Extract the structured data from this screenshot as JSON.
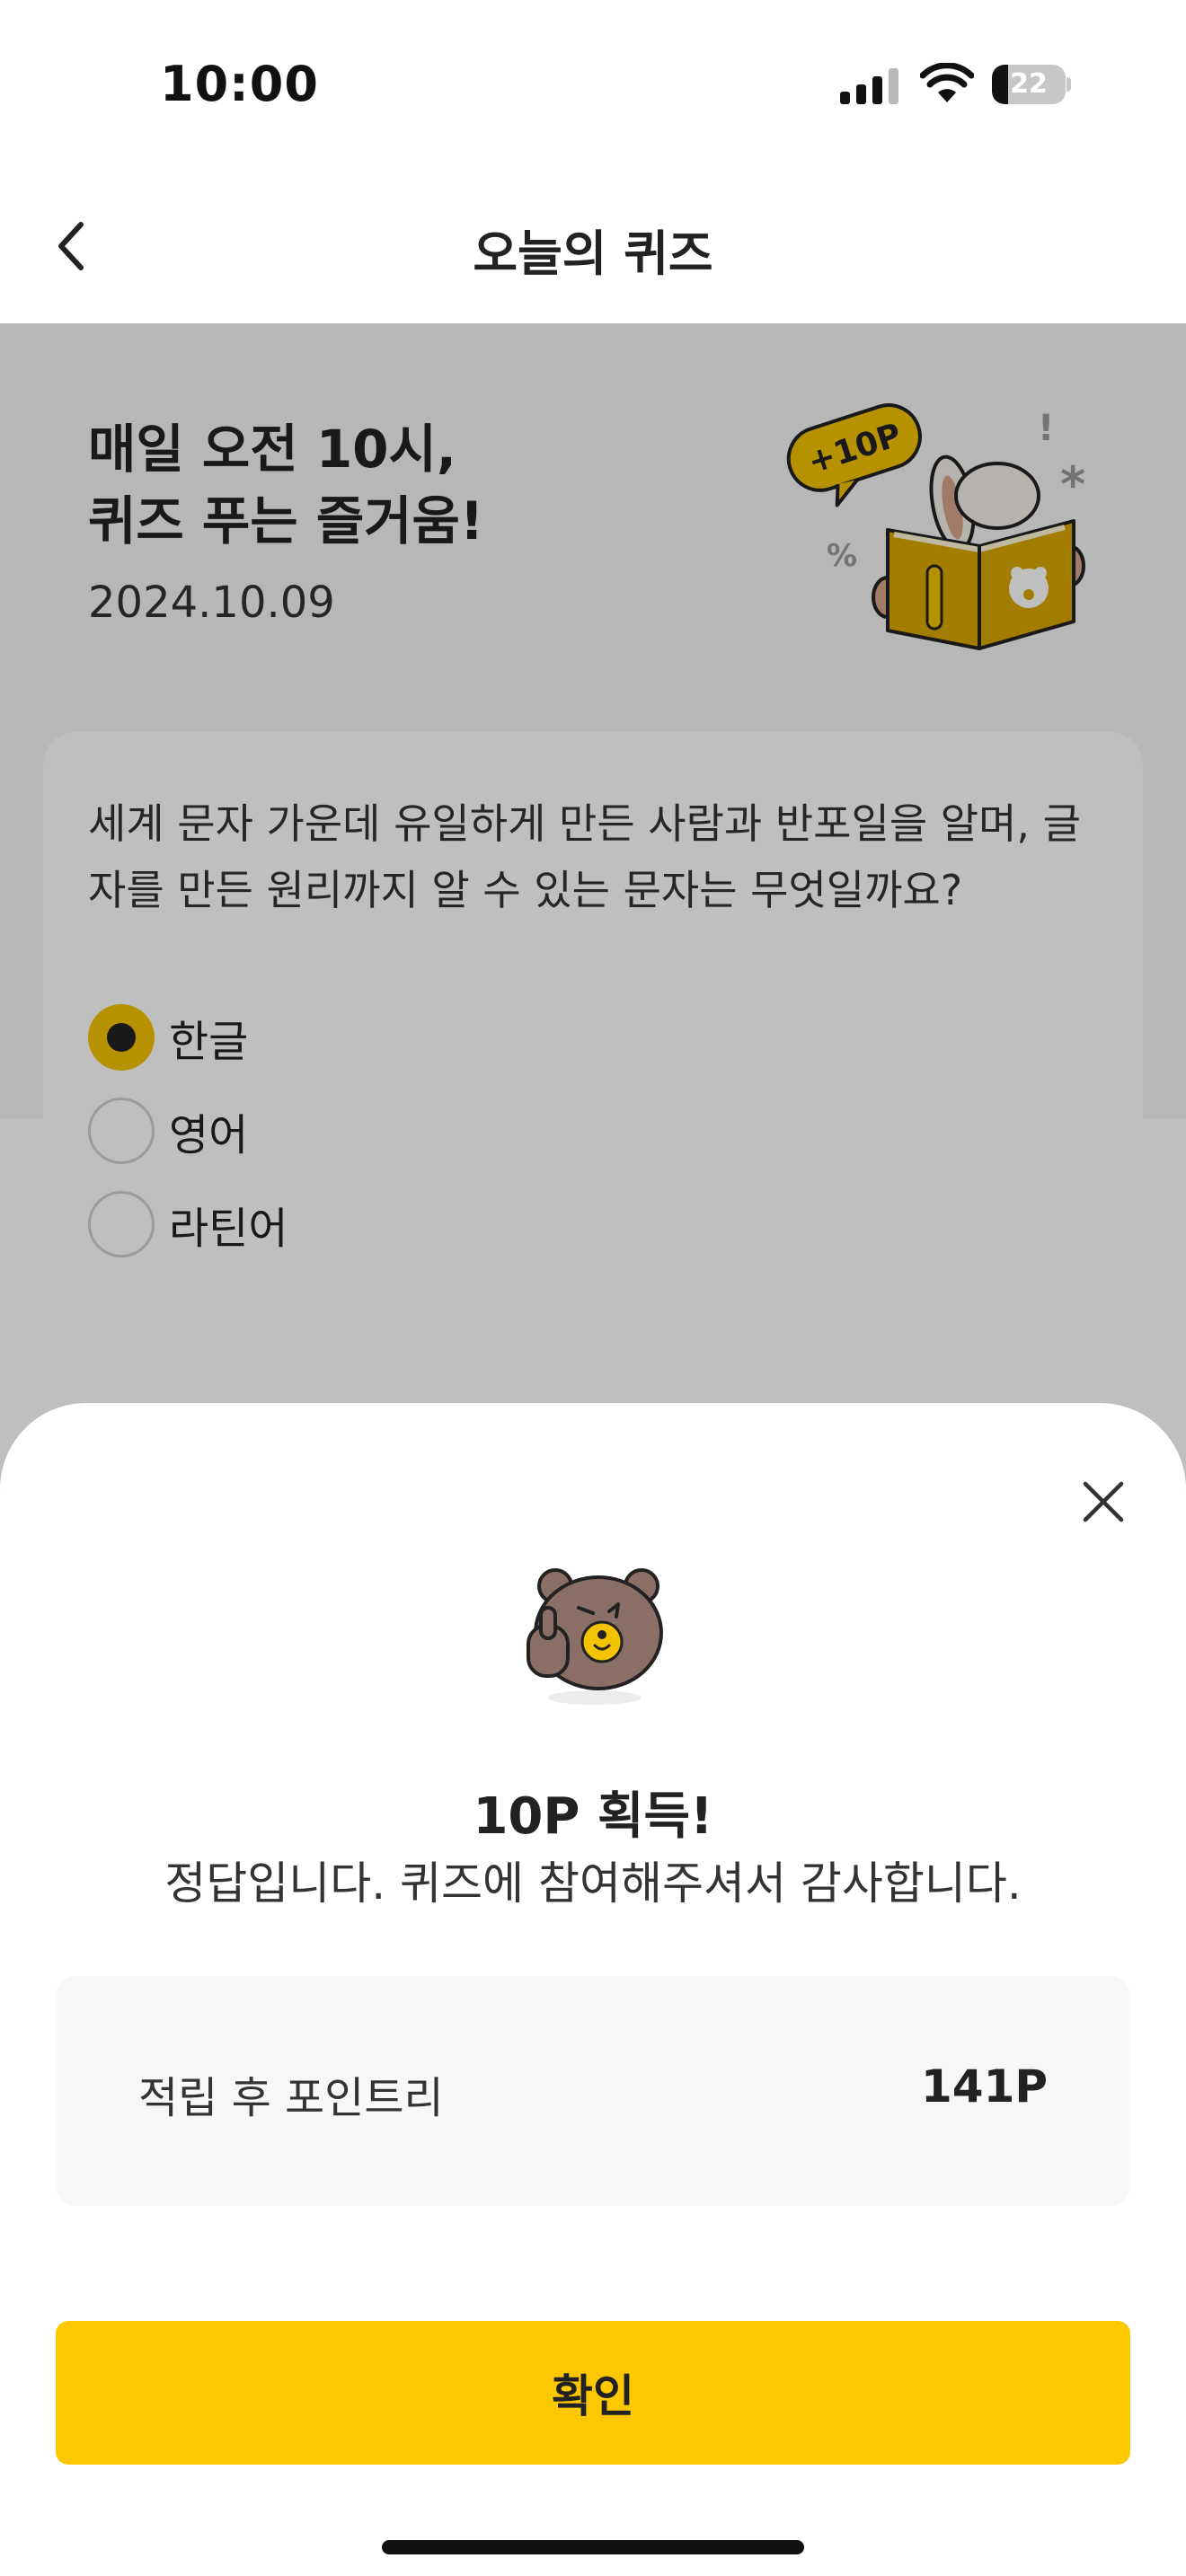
{
  "status_bar": {
    "time": "10:00",
    "battery_level": "22",
    "battery_fraction": 0.22
  },
  "nav": {
    "back_icon": "chevron-left-icon",
    "title": "오늘의 퀴즈"
  },
  "hero": {
    "title": "매일 오전 10시,\n퀴즈 푸는 즐거움!",
    "date": "2024.10.09",
    "badge": "+10P",
    "illustration": "rabbit-reading-book-illustration"
  },
  "quiz": {
    "question": "세계 문자 가운데 유일하게 만든 사람과 반포일을 알며, 글자를 만든 원리까지 알 수 있는 문자는 무엇일까요?",
    "options": [
      {
        "label": "한글",
        "selected": true
      },
      {
        "label": "영어",
        "selected": false
      },
      {
        "label": "라틴어",
        "selected": false
      }
    ]
  },
  "result_sheet": {
    "close_icon": "close-icon",
    "mascot": "bear-thumbs-up-icon",
    "title": "10P 획득!",
    "message": "정답입니다. 퀴즈에 참여해주셔서 감사합니다.",
    "points_label": "적립 후 포인트리",
    "points_value": "141P",
    "confirm_label": "확인"
  },
  "colors": {
    "accent": "#fdc800",
    "radio_selected": "#f3c300",
    "dimmer": "rgba(0,0,0,0.25)",
    "points_box_bg": "#f7f7f7"
  }
}
